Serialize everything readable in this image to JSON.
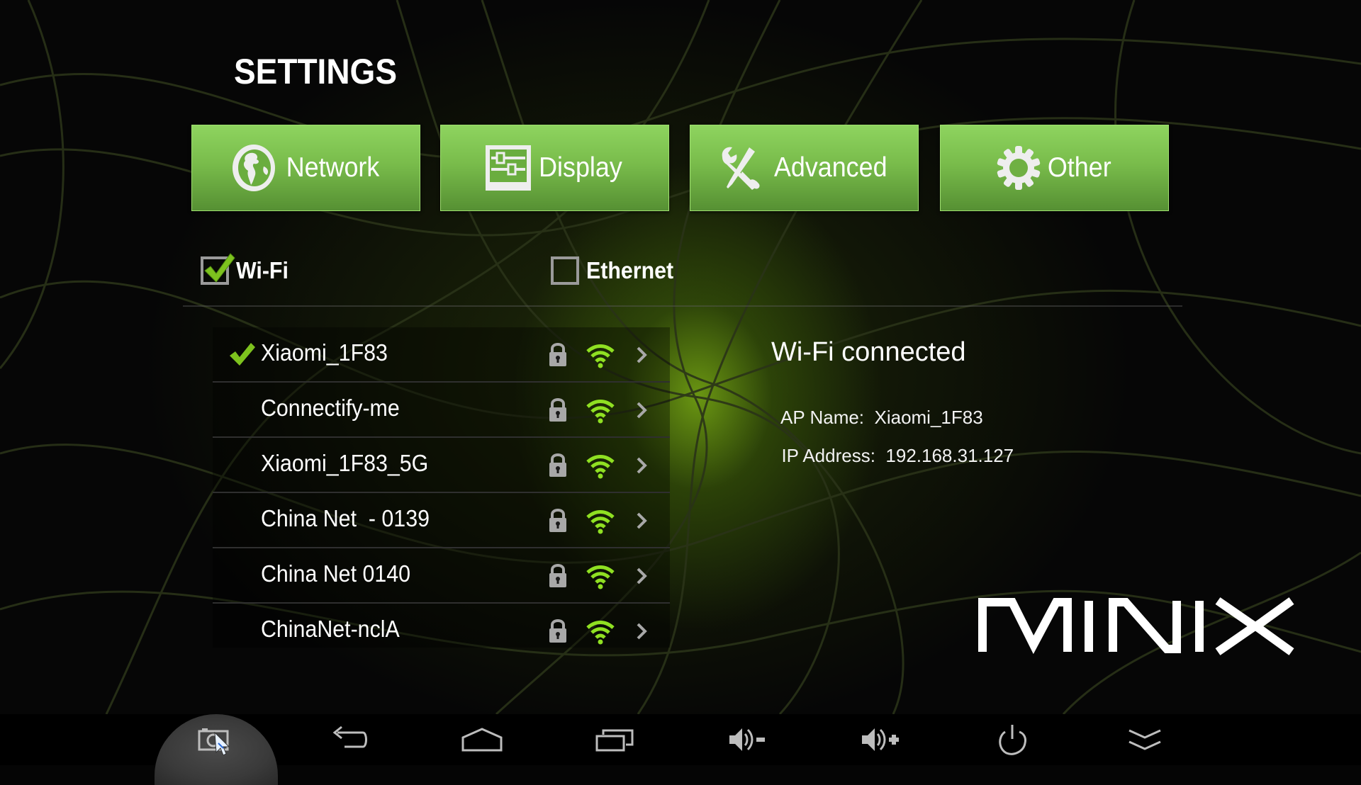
{
  "app": {
    "title": "SETTINGS",
    "brand": "MINIX"
  },
  "colors": {
    "accent": "#7cc242",
    "signal": "#8fe022",
    "check": "#7dc21e",
    "icon_gray": "#a8a8a8"
  },
  "categories": [
    {
      "label": "Network",
      "icon": "globe-icon"
    },
    {
      "label": "Display",
      "icon": "sliders-icon"
    },
    {
      "label": "Advanced",
      "icon": "tools-icon"
    },
    {
      "label": "Other",
      "icon": "gear-icon"
    }
  ],
  "toggles": {
    "wifi": {
      "label": "Wi-Fi",
      "checked": true
    },
    "ethernet": {
      "label": "Ethernet",
      "checked": false
    }
  },
  "networks": [
    {
      "ssid": "Xiaomi_1F83",
      "connected": true,
      "secured": true,
      "signal": "full"
    },
    {
      "ssid": "Connectify-me",
      "connected": false,
      "secured": true,
      "signal": "full"
    },
    {
      "ssid": "Xiaomi_1F83_5G",
      "connected": false,
      "secured": true,
      "signal": "full"
    },
    {
      "ssid": "China Net  - 0139",
      "connected": false,
      "secured": true,
      "signal": "full"
    },
    {
      "ssid": "China Net 0140",
      "connected": false,
      "secured": true,
      "signal": "full"
    },
    {
      "ssid": "ChinaNet-nclA",
      "connected": false,
      "secured": true,
      "signal": "full"
    }
  ],
  "status": {
    "heading": "Wi-Fi connected",
    "ap_label": "AP Name:",
    "ap_value": "Xiaomi_1F83",
    "ip_label": "IP Address:",
    "ip_value": "192.168.31.127"
  },
  "navbar": [
    {
      "name": "screenshot",
      "icon": "screenshot-icon",
      "active": true
    },
    {
      "name": "back",
      "icon": "back-icon"
    },
    {
      "name": "home",
      "icon": "home-icon"
    },
    {
      "name": "recents",
      "icon": "recents-icon"
    },
    {
      "name": "volume-down",
      "icon": "volume-down-icon"
    },
    {
      "name": "volume-up",
      "icon": "volume-up-icon"
    },
    {
      "name": "power",
      "icon": "power-icon"
    },
    {
      "name": "expand",
      "icon": "chevron-double-down-icon"
    }
  ]
}
